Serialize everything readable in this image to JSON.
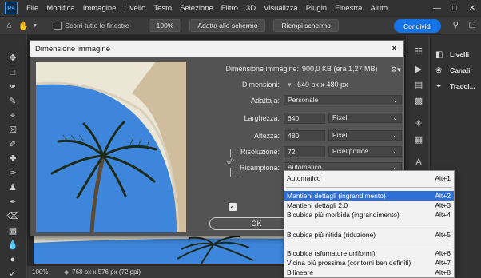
{
  "menubar": {
    "logo": "Ps",
    "items": [
      "File",
      "Modifica",
      "Immagine",
      "Livello",
      "Testo",
      "Selezione",
      "Filtro",
      "3D",
      "Visualizza",
      "Plugin",
      "Finestra",
      "Aiuto"
    ]
  },
  "optionsbar": {
    "scroll_all_label": "Scorri tutte le finestre",
    "zoom_value": "100%",
    "fit_label": "Adatta allo schermo",
    "fill_label": "Riempi schermo",
    "share_label": "Condividi"
  },
  "panels": {
    "items": [
      "Livelli",
      "Canali",
      "Tracci..."
    ]
  },
  "statusbar": {
    "zoom": "100%",
    "info": "768 px x 576 px (72 ppi)"
  },
  "dialog": {
    "title": "Dimensione immagine",
    "size_label": "Dimensione immagine:",
    "size_value": "900,0 KB (era 1,27 MB)",
    "dimensions_label": "Dimensioni:",
    "dimensions_value": "640 px x 480 px",
    "fit_label": "Adatta a:",
    "fit_value": "Personale",
    "width_label": "Larghezza:",
    "width_value": "640",
    "width_unit": "Pixel",
    "height_label": "Altezza:",
    "height_value": "480",
    "height_unit": "Pixel",
    "resolution_label": "Risoluzione:",
    "resolution_value": "72",
    "resolution_unit": "Pixel/pollice",
    "resample_label": "Ricampiona:",
    "resample_value": "Automatico",
    "ok_label": "OK"
  },
  "resample_menu": {
    "selected_index": 1,
    "items": [
      {
        "label": "Automatico",
        "shortcut": "Alt+1"
      },
      {
        "label": "Mantieni dettagli (ingrandimento)",
        "shortcut": "Alt+2"
      },
      {
        "label": "Mantieni dettagli 2.0",
        "shortcut": "Alt+3"
      },
      {
        "label": "Bicubica più morbida (ingrandimento)",
        "shortcut": "Alt+4"
      },
      {
        "label": "Bicubica più nitida (riduzione)",
        "shortcut": "Alt+5"
      },
      {
        "label": "Bicubica (sfumature uniformi)",
        "shortcut": "Alt+6"
      },
      {
        "label": "Vicina più prossima (contorni ben definiti)",
        "shortcut": "Alt+7"
      },
      {
        "label": "Bilineare",
        "shortcut": "Alt+8"
      }
    ]
  },
  "colors": {
    "accent": "#1473e6",
    "selection": "#2f6fd6",
    "sky": "#3d86db",
    "wall": "#e8e1cf"
  }
}
